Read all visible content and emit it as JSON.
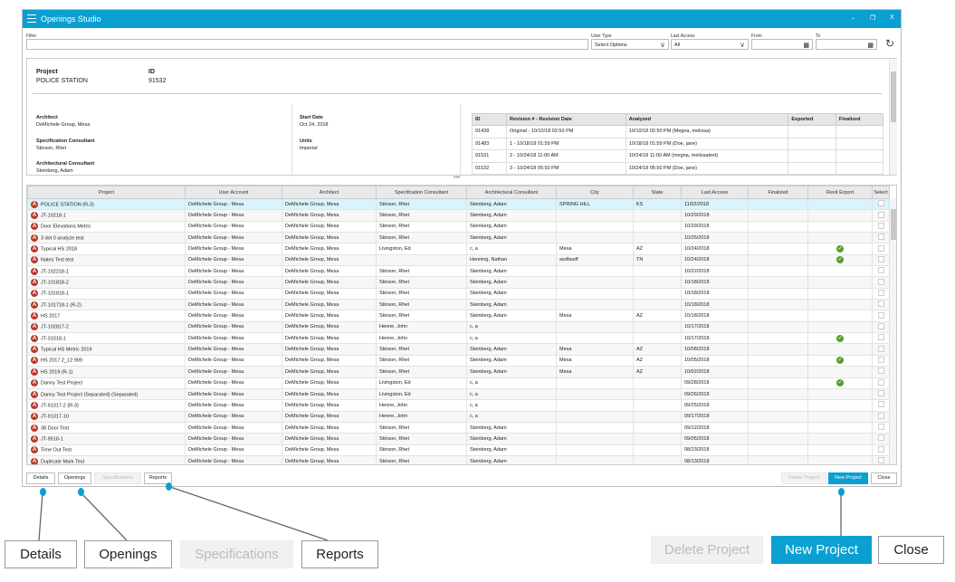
{
  "app": {
    "title": "Openings Studio",
    "minimize": "-",
    "restore": "❐",
    "close": "X"
  },
  "filters": {
    "filter_label": "Filter",
    "filter_value": "",
    "user_type_label": "User Type",
    "user_type_value": "Select Options",
    "last_access_label": "Last Access",
    "last_access_value": "All",
    "from_label": "From",
    "to_label": "To"
  },
  "detail": {
    "project_label": "Project",
    "project_value": "POLICE STATION",
    "id_label": "ID",
    "id_value": "91532",
    "architect_label": "Architect",
    "architect_value": "DeMichele Group, Mesa",
    "spec_label": "Specification Consultant",
    "spec_value": "Stinson, Rhet",
    "arch_cons_label": "Architectural Consultant",
    "arch_cons_value": "Steinberg, Adam",
    "start_label": "Start Date",
    "start_value": "Oct 24, 2018",
    "units_label": "Units",
    "units_value": "Imperial",
    "revisions": {
      "headers": [
        "ID",
        "Revision # - Revision Date",
        "Analyzed",
        "Exported",
        "Finalized"
      ],
      "rows": [
        [
          "91438",
          "Original - 10/10/18 02:50 PM",
          "10/10/18 02:50 PM (Megna, melissa)",
          "",
          ""
        ],
        [
          "91483",
          "1 - 10/18/18 01:59 PM",
          "10/18/18 01:59 PM (Doe, jane)",
          "",
          ""
        ],
        [
          "91531",
          "2 - 10/24/18 11:00 AM",
          "10/24/18 11:00 AM (megna, melissatest)",
          "",
          ""
        ],
        [
          "91532",
          "3 - 10/24/18 05:50 PM",
          "10/24/18 05:50 PM (Doe, jane)",
          "",
          ""
        ]
      ]
    }
  },
  "grid": {
    "headers": [
      "Project",
      "User Account",
      "Architect",
      "Specification Consultant",
      "Architectural Consultant",
      "City",
      "State",
      "Last Access",
      "Finalized",
      "Revit Export",
      "Select"
    ],
    "rows": [
      [
        "POLICE STATION (R-3)",
        "DeMichele Group - Mesa",
        "DeMichele Group, Mesa",
        "Stinson, Rhet",
        "Steinberg, Adam",
        "SPRING HILL",
        "KS",
        "11/02/2018",
        "",
        false
      ],
      [
        "JT-10218-1",
        "DeMichele Group - Mesa",
        "DeMichele Group, Mesa",
        "Stinson, Rhet",
        "Steinberg, Adam",
        "",
        "",
        "10/29/2018",
        "",
        false
      ],
      [
        "Door Elevations Metric",
        "DeMichele Group - Mesa",
        "DeMichele Group, Mesa",
        "Stinson, Rhet",
        "Steinberg, Adam",
        "",
        "",
        "10/29/2018",
        "",
        false
      ],
      [
        "3 dot 0 analyze test",
        "DeMichele Group - Mesa",
        "DeMichele Group, Mesa",
        "Stinson, Rhet",
        "Steinberg, Adam",
        "",
        "",
        "10/25/2018",
        "",
        false
      ],
      [
        "Typical HS 2018",
        "DeMichele Group - Mesa",
        "DeMichele Group, Mesa",
        "Livingston, Ed",
        "c, a",
        "Mesa",
        "AZ",
        "10/24/2018",
        "",
        true
      ],
      [
        "Nates Test test",
        "DeMichele Group - Mesa",
        "DeMichele Group, Mesa",
        "",
        "Henning, Nathan",
        "asdfasdf",
        "TN",
        "10/24/2018",
        "",
        true
      ],
      [
        "JT-102218-1",
        "DeMichele Group - Mesa",
        "DeMichele Group, Mesa",
        "Stinson, Rhet",
        "Steinberg, Adam",
        "",
        "",
        "10/22/2018",
        "",
        false
      ],
      [
        "JT-101818-2",
        "DeMichele Group - Mesa",
        "DeMichele Group, Mesa",
        "Stinson, Rhet",
        "Steinberg, Adam",
        "",
        "",
        "10/18/2018",
        "",
        false
      ],
      [
        "JT-101818-1",
        "DeMichele Group - Mesa",
        "DeMichele Group, Mesa",
        "Stinson, Rhet",
        "Steinberg, Adam",
        "",
        "",
        "10/18/2018",
        "",
        false
      ],
      [
        "JT-101718-1 (R-2)",
        "DeMichele Group - Mesa",
        "DeMichele Group, Mesa",
        "Stinson, Rhet",
        "Steinberg, Adam",
        "",
        "",
        "10/18/2018",
        "",
        false
      ],
      [
        "HS 2017",
        "DeMichele Group - Mesa",
        "DeMichele Group, Mesa",
        "Stinson, Rhet",
        "Steinberg, Adam",
        "Mesa",
        "AZ",
        "10/18/2018",
        "",
        false
      ],
      [
        "JT-102817-2",
        "DeMichele Group - Mesa",
        "DeMichele Group, Mesa",
        "Henne, John",
        "c, a",
        "",
        "",
        "10/17/2018",
        "",
        false
      ],
      [
        "JT-31018-1",
        "DeMichele Group - Mesa",
        "DeMichele Group, Mesa",
        "Henne, John",
        "c, a",
        "",
        "",
        "10/17/2018",
        "",
        true
      ],
      [
        "Typical HS Metric 2019",
        "DeMichele Group - Mesa",
        "DeMichele Group, Mesa",
        "Stinson, Rhet",
        "Steinberg, Adam",
        "Mesa",
        "AZ",
        "10/08/2018",
        "",
        false
      ],
      [
        "HS 2017 2_12 909",
        "DeMichele Group - Mesa",
        "DeMichele Group, Mesa",
        "Stinson, Rhet",
        "Steinberg, Adam",
        "Mesa",
        "AZ",
        "10/05/2018",
        "",
        true
      ],
      [
        "HS 2019 (R-1)",
        "DeMichele Group - Mesa",
        "DeMichele Group, Mesa",
        "Stinson, Rhet",
        "Steinberg, Adam",
        "Mesa",
        "AZ",
        "10/02/2018",
        "",
        false
      ],
      [
        "Danny Test Project",
        "DeMichele Group - Mesa",
        "DeMichele Group, Mesa",
        "Livingston, Ed",
        "c, a",
        "",
        "",
        "09/28/2018",
        "",
        true
      ],
      [
        "Danny Test Project (Separated) (Separated)",
        "DeMichele Group - Mesa",
        "DeMichele Group, Mesa",
        "Livingston, Ed",
        "c, a",
        "",
        "",
        "09/26/2018",
        "",
        false
      ],
      [
        "JT-91317-2 (R-3)",
        "DeMichele Group - Mesa",
        "DeMichele Group, Mesa",
        "Henne, John",
        "c, a",
        "",
        "",
        "09/25/2018",
        "",
        false
      ],
      [
        "JT-91317-10",
        "DeMichele Group - Mesa",
        "DeMichele Group, Mesa",
        "Henne, John",
        "c, a",
        "",
        "",
        "09/17/2018",
        "",
        false
      ],
      [
        "38 Door Test",
        "DeMichele Group - Mesa",
        "DeMichele Group, Mesa",
        "Stinson, Rhet",
        "Steinberg, Adam",
        "",
        "",
        "09/12/2018",
        "",
        false
      ],
      [
        "JT-9518-1",
        "DeMichele Group - Mesa",
        "DeMichele Group, Mesa",
        "Stinson, Rhet",
        "Steinberg, Adam",
        "",
        "",
        "09/05/2018",
        "",
        false
      ],
      [
        "Time Out Test",
        "DeMichele Group - Mesa",
        "DeMichele Group, Mesa",
        "Stinson, Rhet",
        "Steinberg, Adam",
        "",
        "",
        "08/23/2018",
        "",
        false
      ],
      [
        "Duplicate Mark Test",
        "DeMichele Group - Mesa",
        "DeMichele Group, Mesa",
        "Stinson, Rhet",
        "Steinberg, Adam",
        "",
        "",
        "08/13/2018",
        "",
        false
      ]
    ]
  },
  "buttons": {
    "details": "Details",
    "openings": "Openings",
    "specifications": "Specifications",
    "reports": "Reports",
    "delete_project": "Delete Project",
    "new_project": "New Project",
    "close": "Close"
  },
  "colors": {
    "accent": "#0aa0d2",
    "project_icon": "#b83a2c",
    "check": "#5a9e2e",
    "selected_row": "#d9f4fc"
  }
}
